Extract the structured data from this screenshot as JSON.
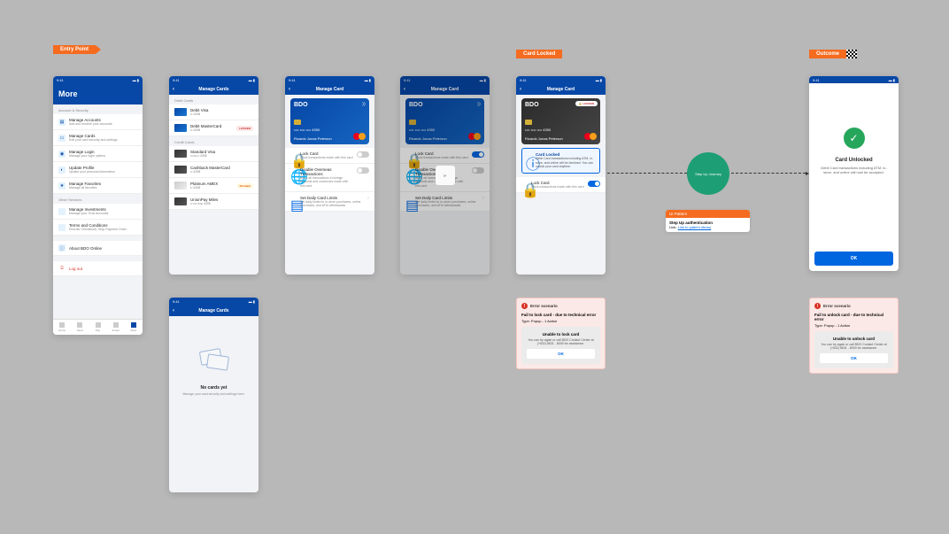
{
  "tags": {
    "entry": "Entry Point",
    "locked": "Card Locked",
    "outcome": "Outcome"
  },
  "statusbar": {
    "time": "9:41"
  },
  "screen1": {
    "title": "More",
    "sec1": "Account & Security",
    "items": [
      {
        "title": "Manage Accounts",
        "sub": "Add and rename your accounts"
      },
      {
        "title": "Manage Cards",
        "sub": "Edit your card security and settings"
      },
      {
        "title": "Manage Login",
        "sub": "Manage your login options"
      },
      {
        "title": "Update Profile",
        "sub": "Update your personal information"
      },
      {
        "title": "Manage Favorites",
        "sub": "Manage all favorites"
      }
    ],
    "sec2": "Other Services",
    "items2": [
      {
        "title": "Manage Investments",
        "sub": "Manage your Trust Accounts"
      },
      {
        "title": "Terms and Conditions",
        "sub": "Reorder Checkbook, Stop Payment Order"
      }
    ],
    "about": "About BDO Online",
    "logout": "Log out",
    "tabs": [
      "Home",
      "Send",
      "Pay",
      "Invest",
      "More"
    ]
  },
  "screen2": {
    "title": "Manage Cards",
    "sec1": "Debit Cards",
    "debit": [
      {
        "name": "Debit Visa",
        "num": "•• 4398"
      },
      {
        "name": "Debit MasterCard",
        "num": "•• 4398",
        "badge": "LOCKED"
      }
    ],
    "sec2": "Credit Cards",
    "credit": [
      {
        "name": "Standard Visa",
        "num": "•••••••• 4398"
      },
      {
        "name": "Cashback MasterCard",
        "num": "•• 4398"
      },
      {
        "name": "Platinum AMEX",
        "num": "•• 4398",
        "badge": "Dormant"
      },
      {
        "name": "UnionPay Miles",
        "num": "•• no exp 4398"
      }
    ]
  },
  "screen_empty": {
    "title": "Manage Cards",
    "heading": "No cards yet",
    "sub": "Manage your card security and settings here."
  },
  "screen3": {
    "title": "Manage Card",
    "card": {
      "logo": "BDO",
      "num": "•••• •••• •••• 4350",
      "name": "Ricardo Jonas Peterson"
    },
    "opts": [
      {
        "title": "Lock Card",
        "sub": "Block transactions made with this card",
        "toggle": "off"
      },
      {
        "title": "Disable Overseas Transactions",
        "sub": "Block all transactions in foreign amounts and currencies made with this card",
        "toggle": "off"
      },
      {
        "title": "Set Daily Card Limits",
        "sub": "Set daily limits for in-store purchases, online purchases, and ATM withdrawals",
        "chevron": true
      }
    ]
  },
  "screen4": {
    "title": "Manage Card",
    "card": {
      "logo": "BDO",
      "num": "•••• •••• •••• 4350",
      "name": "Ricardo Jonas Peterson"
    },
    "opts": [
      {
        "title": "Lock Card",
        "sub": "Block transactions made with this card",
        "toggle": "on"
      },
      {
        "title": "Disable Overseas Transactions",
        "sub": "Block all transactions in foreign amounts and currencies made with this card",
        "toggle": "off"
      },
      {
        "title": "Set Daily Card Limits",
        "sub": "Set daily limits for in-store purchases, online purchases, and ATM withdrawals",
        "chevron": true
      }
    ]
  },
  "screen5": {
    "title": "Manage Card",
    "card": {
      "logo": "BDO",
      "badge": "LOCKED",
      "num": "•••• •••• •••• 4350",
      "name": "Ricardo Jonas Peterson"
    },
    "notice": {
      "title": "Card Locked",
      "sub": "Debit Card transactions including ATM, in-store, and online will be declined. You can unlock your card anytime."
    },
    "opt": {
      "title": "Lock Card",
      "sub": "Block transactions made with this card",
      "toggle": "on"
    }
  },
  "screen_success": {
    "title": "Card Unlocked",
    "sub": "Debit Card transactions including ATM, in-store, and online will now be accepted.",
    "btn": "OK"
  },
  "bubble": "Step Up Journey",
  "note": {
    "hdr": "UI Pattern",
    "title": "Step Up authentication",
    "link_label": "Link:",
    "link": "Link to pattern library"
  },
  "err1": {
    "hdr": "Error scenario",
    "title": "Fail to lock card - due to technical error",
    "type": "Type: Popup - 1 Action",
    "d_title": "Unable to lock card",
    "d_sub": "You can try again or call BDO Contact Center at (+632) 8631 - 8000 for assistance.",
    "d_btn": "OK"
  },
  "err2": {
    "hdr": "Error scenario",
    "title": "Fail to unlock card - due to technical error",
    "type": "Type: Popup - 1 Action",
    "d_title": "Unable to unlock card",
    "d_sub": "You can try again or call BDO Contact Center at (+632) 8631 - 8000 for assistance.",
    "d_btn": "OK"
  }
}
